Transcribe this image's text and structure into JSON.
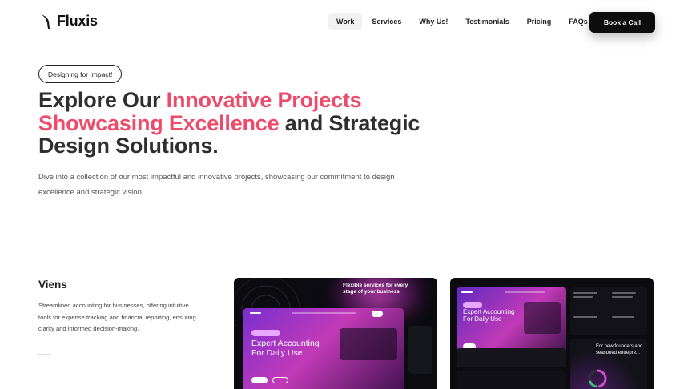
{
  "nav": {
    "logo_text": "Fluxis",
    "items": [
      {
        "label": "Work",
        "active": true
      },
      {
        "label": "Services",
        "active": false
      },
      {
        "label": "Why Us!",
        "active": false
      },
      {
        "label": "Testimonials",
        "active": false
      },
      {
        "label": "Pricing",
        "active": false
      },
      {
        "label": "FAQs",
        "active": false
      }
    ],
    "cta_label": "Book a Call"
  },
  "hero": {
    "pill": "Designing for Impact!",
    "headline": {
      "p1": "Explore Our ",
      "p2": "Innovative Projects",
      "p3": "Showcasing Excellence",
      "p4": " and Strategic",
      "p5": "Design Solutions."
    },
    "subtitle": "Dive into a collection of our most impactful and innovative projects, showcasing our commitment to design excellence and strategic vision."
  },
  "project": {
    "title": "Viens",
    "description": "Streamlined accounting for businesses, offering intuitive tools for expense tracking and financial reporting, ensuring clarity and informed decision-making.",
    "card1": {
      "banner": "Flexible services for every stage of your business",
      "hero_text": "Expert Accounting For Daily Use"
    },
    "card2": {
      "hero_text": "Expert Accounting For Daily Use",
      "side_text": "For new founders and seasoned entrepre..."
    }
  },
  "colors": {
    "accent": "#ee4b6b",
    "dark": "#0d0d0d",
    "text": "#2f2f33"
  }
}
